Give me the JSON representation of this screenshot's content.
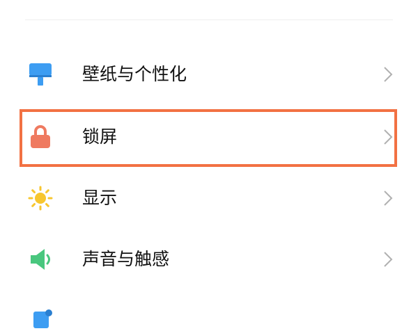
{
  "settings": {
    "items": [
      {
        "label": "壁纸与个性化",
        "icon": "wallpaper-icon",
        "color": "#3d9df2"
      },
      {
        "label": "锁屏",
        "icon": "lock-icon",
        "color": "#ef7a60"
      },
      {
        "label": "显示",
        "icon": "sun-icon",
        "color": "#f7c62f"
      },
      {
        "label": "声音与触感",
        "icon": "speaker-icon",
        "color": "#49c77e"
      }
    ],
    "highlight_color": "#f27143",
    "chevron_color": "#b0b0b0"
  }
}
